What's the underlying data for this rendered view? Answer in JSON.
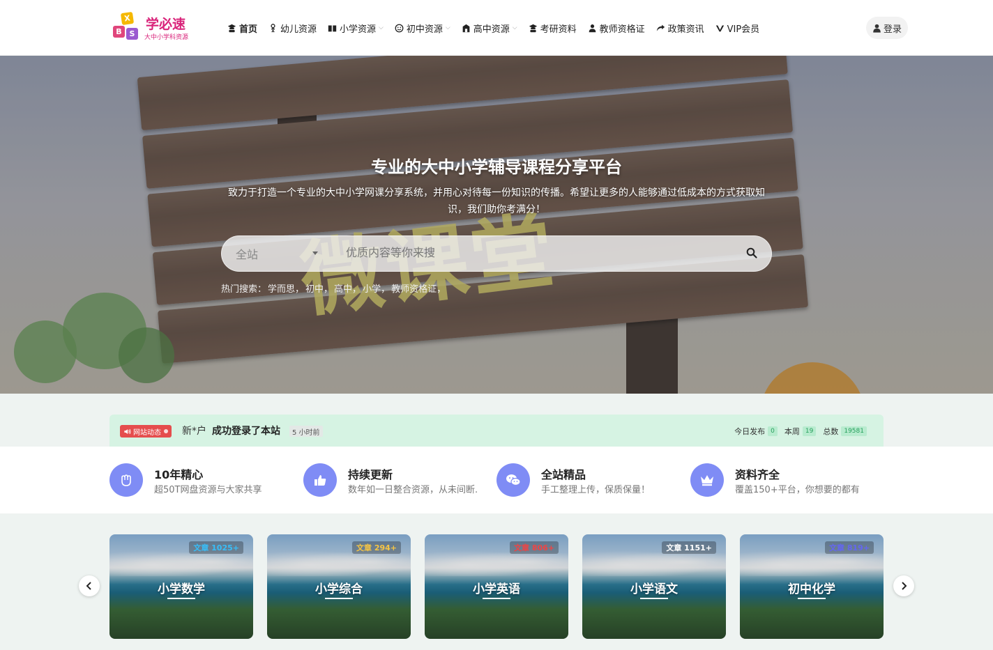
{
  "logo": {
    "name": "学必速",
    "slogan": "大中小学科资源",
    "letters": [
      "X",
      "B",
      "S"
    ]
  },
  "nav": [
    {
      "label": "首页",
      "icon": "graduate-icon",
      "dropdown": false,
      "active": true
    },
    {
      "label": "幼儿资源",
      "icon": "child-icon",
      "dropdown": false,
      "active": false
    },
    {
      "label": "小学资源",
      "icon": "book-icon",
      "dropdown": true,
      "active": false
    },
    {
      "label": "初中资源",
      "icon": "smile-icon",
      "dropdown": true,
      "active": false
    },
    {
      "label": "高中资源",
      "icon": "school-icon",
      "dropdown": true,
      "active": false
    },
    {
      "label": "考研资料",
      "icon": "graduate-icon",
      "dropdown": false,
      "active": false
    },
    {
      "label": "教师资格证",
      "icon": "teacher-icon",
      "dropdown": false,
      "active": false
    },
    {
      "label": "政策资讯",
      "icon": "share-icon",
      "dropdown": false,
      "active": false
    },
    {
      "label": "VIP会员",
      "icon": "vip-icon",
      "dropdown": false,
      "active": false
    }
  ],
  "login_label": "登录",
  "hero": {
    "title": "专业的大中小学辅导课程分享平台",
    "subtitle": "致力于打造一个专业的大中小学网课分享系统，并用心对待每一份知识的传播。希望让更多的人能够通过低成本的方式获取知识，我们助你考满分！",
    "image_text": "微课堂"
  },
  "search": {
    "scope": "全站",
    "placeholder": "优质内容等你来搜"
  },
  "hot_search": {
    "label": "热门搜索：",
    "items": [
      "学而思，",
      "初中，",
      "高中，",
      "小学，",
      "教师资格证，"
    ]
  },
  "notice": {
    "tag": "网站动态",
    "user": "新*户",
    "action": "成功登录了本站",
    "time": "5 小时前",
    "stats": [
      {
        "label": "今日发布",
        "count": "0"
      },
      {
        "label": "本周",
        "count": "19"
      },
      {
        "label": "总数",
        "count": "19581"
      }
    ]
  },
  "features": [
    {
      "title": "10年精心",
      "desc": "超50T网盘资源与大家共享",
      "icon": "hand-icon"
    },
    {
      "title": "持续更新",
      "desc": "数年如一日整合资源，从未间断.",
      "icon": "thumbs-up-icon"
    },
    {
      "title": "全站精品",
      "desc": "手工整理上传，保质保量！",
      "icon": "wechat-icon"
    },
    {
      "title": "资料齐全",
      "desc": "覆盖150+平台，你想要的都有",
      "icon": "crown-icon"
    }
  ],
  "categories": [
    {
      "name": "小学数学",
      "badge": "文章 1025+",
      "badge_color": "#38bdf8"
    },
    {
      "name": "小学综合",
      "badge": "文章 294+",
      "badge_color": "#f6c544"
    },
    {
      "name": "小学英语",
      "badge": "文章 806+",
      "badge_color": "#ef4444"
    },
    {
      "name": "小学语文",
      "badge": "文章 1151+",
      "badge_color": "#ffffff"
    },
    {
      "name": "初中化学",
      "badge": "文章 819+",
      "badge_color": "#6366f1"
    }
  ],
  "colors": {
    "brand": "#d9237a",
    "feature_icon_bg": "#7f8cf5",
    "notice_bg": "#d6f3e3",
    "notice_tag": "#e54d4d"
  }
}
